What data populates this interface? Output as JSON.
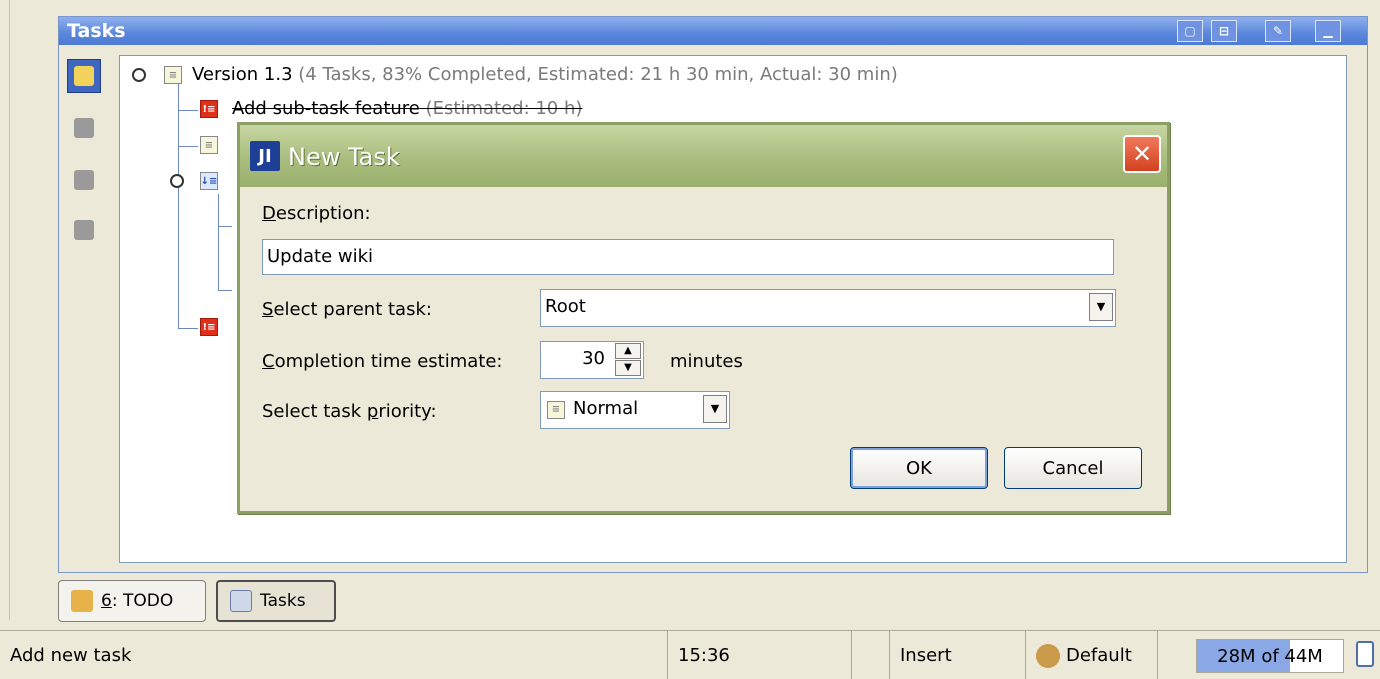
{
  "panel": {
    "title": "Tasks",
    "buttons": [
      "float-icon",
      "dock-icon",
      "pin-icon",
      "minimize-icon"
    ]
  },
  "side_toolbar": {
    "tools": [
      "add-task-icon",
      "remove-task-icon",
      "edit-task-icon",
      "task-list-icon"
    ]
  },
  "tree": {
    "root": {
      "name": "Version 1.3",
      "details": "(4 Tasks, 83% Completed, Estimated: 21 h 30 min, Actual: 30 min)"
    },
    "first_child": {
      "name": "Add sub-task feature",
      "details": "(Estimated: 10 h)"
    }
  },
  "dialog": {
    "title": "New Task",
    "description_label": "Description:",
    "description_underline": "D",
    "description_rest": "escription:",
    "description_value": "Update wiki",
    "parent_label_u": "S",
    "parent_label_rest": "elect parent task:",
    "parent_value": "Root",
    "estimate_label_u": "C",
    "estimate_label_rest": "ompletion time estimate:",
    "estimate_value": "30",
    "estimate_unit": "minutes",
    "priority_label_pre": "Select task ",
    "priority_label_u": "p",
    "priority_label_rest": "riority:",
    "priority_value": "Normal",
    "ok_label": "OK",
    "cancel_label": "Cancel"
  },
  "tabs": {
    "todo_number": "6",
    "todo_label": ": TODO",
    "tasks_label": "Tasks"
  },
  "status": {
    "message": "Add new task",
    "position": "15:36",
    "mode": "Insert",
    "profile": "Default",
    "memory": "28M of 44M",
    "memory_used_fraction": 0.64
  }
}
